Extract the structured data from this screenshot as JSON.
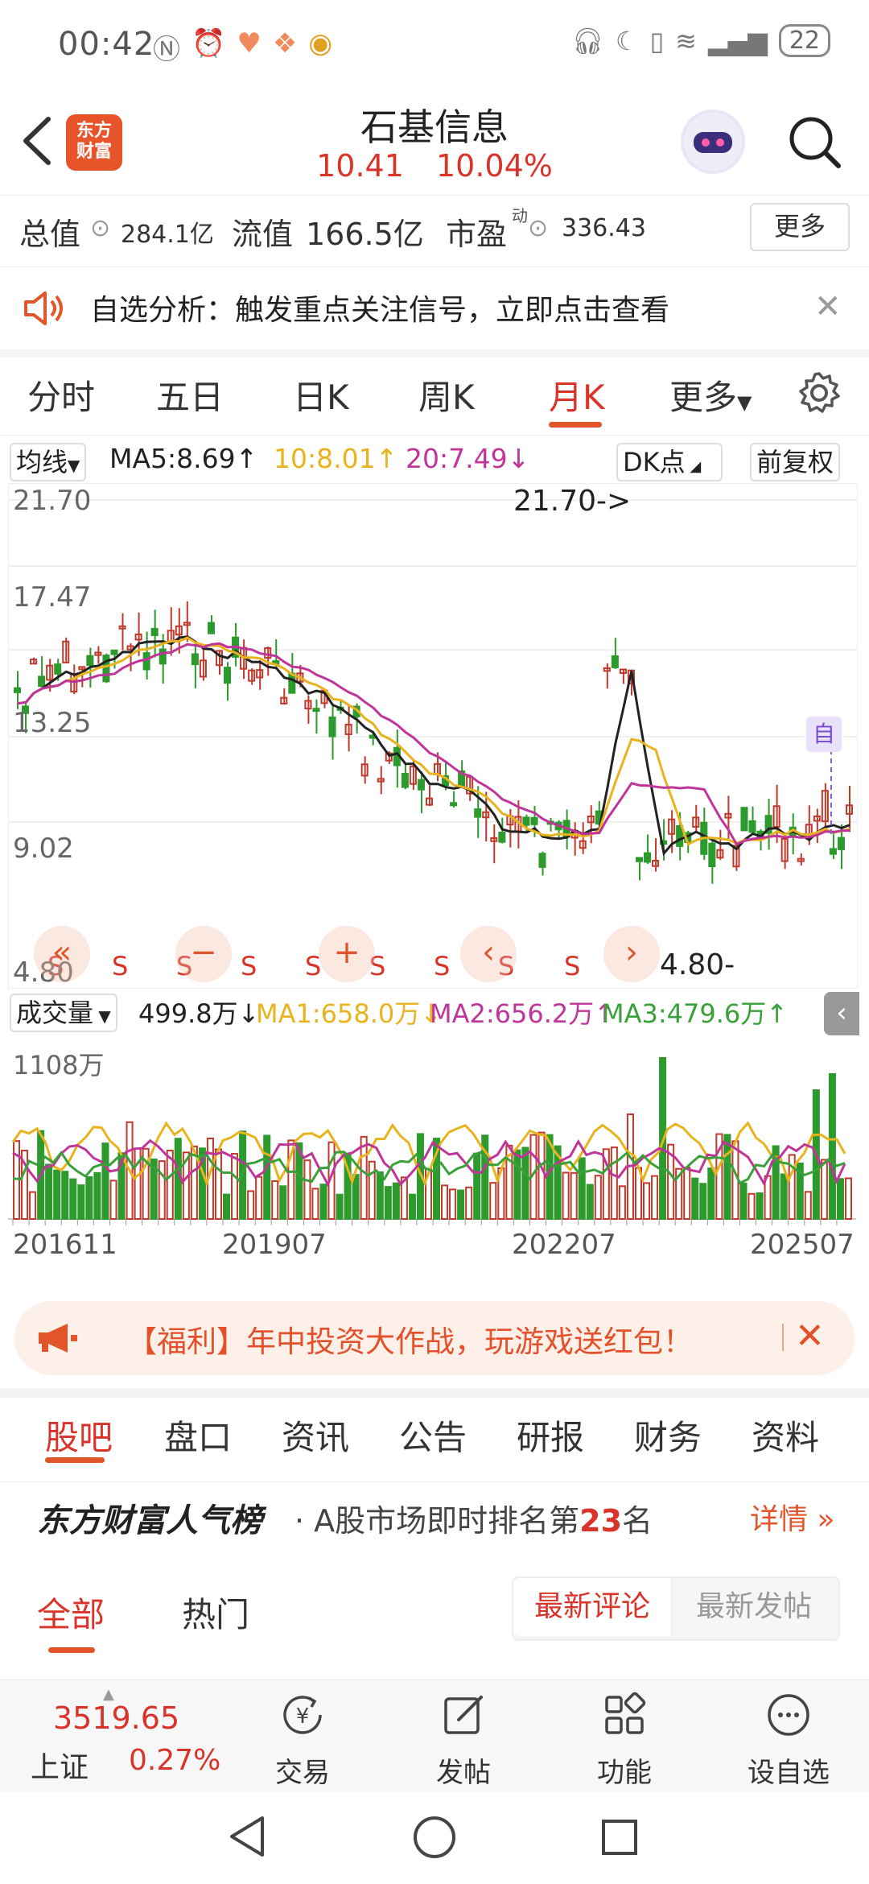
{
  "status": {
    "time": "00:42",
    "battery": "22"
  },
  "header": {
    "stock_name": "石基信息",
    "price": "10.41",
    "change": "10.04%",
    "logo_line1": "东方",
    "logo_line2": "财富"
  },
  "metrics": {
    "total_label": "总值",
    "total_value": "284.1亿",
    "float_label": "流值",
    "float_value": "166.5亿",
    "pe_label": "市盈",
    "pe_sup": "动",
    "pe_value": "336.43",
    "more": "更多"
  },
  "notice": {
    "text": "自选分析：触发重点关注信号，立即点击查看"
  },
  "period_tabs": [
    "分时",
    "五日",
    "日K",
    "周K",
    "月K",
    "更多"
  ],
  "active_period": "月K",
  "ma_row": {
    "selector": "均线",
    "ma5": "MA5:8.69↑",
    "ma10": "10:8.01↑",
    "ma20": "20:7.49↓",
    "dk": "DK点",
    "adjust": "前复权",
    "colors": {
      "ma5": "#222222",
      "ma10": "#e8b31c",
      "ma20": "#c0359a"
    }
  },
  "chart_data": {
    "type": "candlestick",
    "price_axis": {
      "ticks": [
        "21.70",
        "17.47",
        "13.25",
        "9.02",
        "4.80"
      ],
      "min": 4.8,
      "max": 21.7
    },
    "max_label": "21.70->",
    "min_label": "4.80-",
    "marker": "自",
    "s_labels": [
      "S",
      "S",
      "S",
      "S",
      "S",
      "S",
      "S",
      "S",
      "S"
    ],
    "volume": {
      "selector": "成交量",
      "value": "499.8万↓",
      "ma1": "MA1:658.0万↓",
      "ma2": "MA2:656.2万↑",
      "ma3": "MA3:479.6万↑",
      "max": "1108万"
    },
    "date_ticks": [
      "201611",
      "201907",
      "202207",
      "202507"
    ]
  },
  "welfare": {
    "text": "【福利】年中投资大作战，玩游戏送红包！"
  },
  "sub_tabs": [
    "股吧",
    "盘口",
    "资讯",
    "公告",
    "研报",
    "财务",
    "资料"
  ],
  "ranking": {
    "brand": "东方财富人气榜",
    "text_before": "· A股市场即时排名第",
    "rank": "23",
    "text_after": "名",
    "detail": "详情 »"
  },
  "filter": {
    "all": "全部",
    "hot": "热门",
    "latest_comment": "最新评论",
    "latest_post": "最新发帖"
  },
  "bottom": {
    "index_value": "3519.65",
    "index_label": "上证",
    "index_change": "0.27%",
    "trade": "交易",
    "post": "发帖",
    "func": "功能",
    "watch": "设自选"
  }
}
